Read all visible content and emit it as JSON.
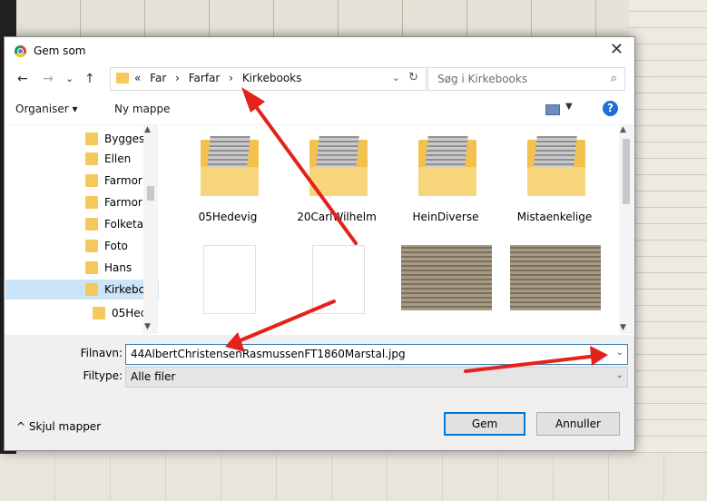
{
  "dialog": {
    "title": "Gem som",
    "close": "✕"
  },
  "nav": {
    "back": "←",
    "forward": "→",
    "recent": "⌄",
    "up": "↑",
    "breadcrumb": [
      "«",
      "Far",
      "›",
      "Farfar",
      "›",
      "Kirkebooks"
    ],
    "search_placeholder": "Søg i Kirkebooks"
  },
  "toolbar": {
    "organize": "Organiser ▾",
    "new_folder": "Ny mappe",
    "help": "?"
  },
  "sidebar": {
    "items": [
      {
        "label": "Bygges"
      },
      {
        "label": "Ellen"
      },
      {
        "label": "Farmor"
      },
      {
        "label": "Farmor"
      },
      {
        "label": "Folketa"
      },
      {
        "label": "Foto"
      },
      {
        "label": "Hans"
      },
      {
        "label": "Kirkebc"
      },
      {
        "label": "05Hec"
      }
    ]
  },
  "files": [
    {
      "name": "05Hedevig",
      "kind": "folder"
    },
    {
      "name": "20CarlWilhelm",
      "kind": "folder"
    },
    {
      "name": "HeinDiverse",
      "kind": "folder"
    },
    {
      "name": "Mistaenkelige",
      "kind": "folder"
    },
    {
      "name": "",
      "kind": "blank"
    },
    {
      "name": "",
      "kind": "blank"
    },
    {
      "name": "",
      "kind": "image"
    },
    {
      "name": "",
      "kind": "image"
    }
  ],
  "form": {
    "filename_label": "Filnavn:",
    "filename_value": "44AlbertChristensenRasmussenFT1860Marstal.jpg",
    "filetype_label": "Filtype:",
    "filetype_value": "Alle filer",
    "hide_folders": "Skjul mapper",
    "save": "Gem",
    "cancel": "Annuller"
  },
  "colors": {
    "accent": "#0078d7",
    "annotation_arrow": "#e3231b",
    "folder": "#f5c85b"
  }
}
